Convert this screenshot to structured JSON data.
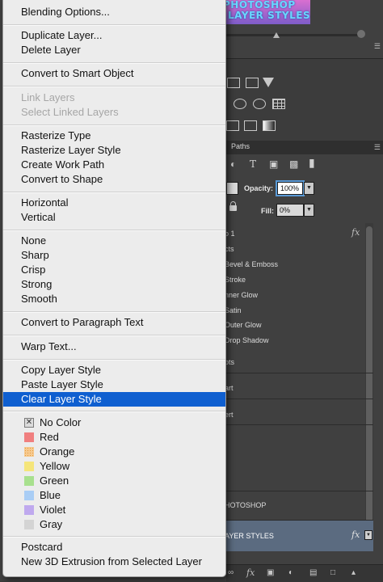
{
  "background": {
    "thumbnail_lines": [
      "PHOTOSHOP",
      "LAYER STYLES"
    ],
    "panel_tabs": [
      "Paths"
    ],
    "opacity_label": "Opacity:",
    "opacity_value": "100%",
    "fill_label": "Fill:",
    "fill_value": "0%",
    "layers": [
      {
        "label": "o 1",
        "fx": "fx"
      },
      {
        "label": "cts"
      },
      {
        "label": "Bevel & Emboss"
      },
      {
        "label": "Stroke"
      },
      {
        "label": "nner Glow"
      },
      {
        "label": "Satin"
      },
      {
        "label": "Outer Glow"
      },
      {
        "label": "Drop Shadow"
      },
      {
        "label": "pts"
      },
      {
        "label": "art"
      },
      {
        "label": "ert"
      },
      {
        "label": "HOTOSHOP"
      },
      {
        "label": "AYER STYLES",
        "fx": "fx"
      }
    ],
    "fx_symbol": "fx",
    "highlight_color": "#5b6b80"
  },
  "menu": {
    "highlight_color": "#0f5fd0",
    "items": [
      {
        "label": "Blending Options..."
      },
      {
        "label": "Duplicate Layer..."
      },
      {
        "label": "Delete Layer"
      },
      {
        "label": "Convert to Smart Object"
      },
      {
        "label": "Link Layers",
        "disabled": true
      },
      {
        "label": "Select Linked Layers",
        "disabled": true
      },
      {
        "label": "Rasterize Type"
      },
      {
        "label": "Rasterize Layer Style"
      },
      {
        "label": "Create Work Path"
      },
      {
        "label": "Convert to Shape"
      },
      {
        "label": "Horizontal"
      },
      {
        "label": "Vertical"
      },
      {
        "label": "None"
      },
      {
        "label": "Sharp"
      },
      {
        "label": "Crisp"
      },
      {
        "label": "Strong"
      },
      {
        "label": "Smooth"
      },
      {
        "label": "Convert to Paragraph Text"
      },
      {
        "label": "Warp Text..."
      },
      {
        "label": "Copy Layer Style"
      },
      {
        "label": "Paste Layer Style"
      },
      {
        "label": "Clear Layer Style",
        "highlighted": true
      },
      {
        "label": "Postcard"
      },
      {
        "label": "New 3D Extrusion from Selected Layer"
      }
    ],
    "colors": [
      {
        "label": "No Color",
        "swatch": "none"
      },
      {
        "label": "Red",
        "swatch": "#f07f7f"
      },
      {
        "label": "Orange",
        "swatch": "#efb061"
      },
      {
        "label": "Yellow",
        "swatch": "#f5e57a"
      },
      {
        "label": "Green",
        "swatch": "#a8e08e"
      },
      {
        "label": "Blue",
        "swatch": "#a9cdf5"
      },
      {
        "label": "Violet",
        "swatch": "#bfa9ee"
      },
      {
        "label": "Gray",
        "swatch": "#d4d4d4"
      }
    ]
  }
}
